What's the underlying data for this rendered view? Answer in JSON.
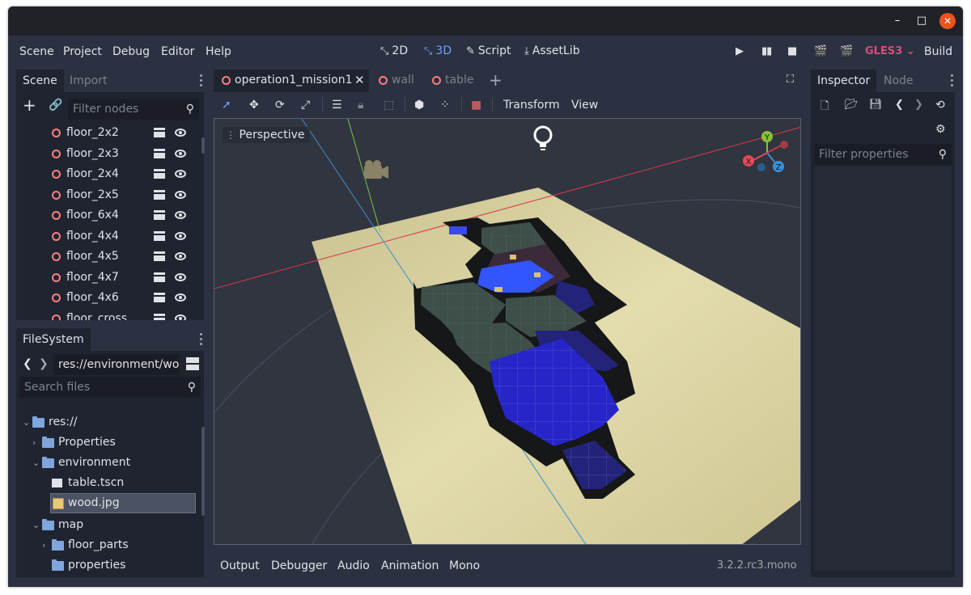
{
  "window": {
    "controls": {
      "minimize": "–",
      "maximize": "□",
      "close": "✕"
    }
  },
  "menu": {
    "items": [
      "Scene",
      "Project",
      "Debug",
      "Editor",
      "Help"
    ],
    "workspaces": [
      {
        "label": "2D",
        "icon": "2d-icon",
        "active": false
      },
      {
        "label": "3D",
        "icon": "3d-icon",
        "active": true
      },
      {
        "label": "Script",
        "icon": "script-icon",
        "active": false
      },
      {
        "label": "AssetLib",
        "icon": "assetlib-icon",
        "active": false
      }
    ],
    "renderer": "GLES3",
    "build_label": "Build",
    "accent_color": "#d7507a"
  },
  "scene_panel": {
    "tabs": [
      "Scene",
      "Import"
    ],
    "filter_placeholder": "Filter nodes",
    "nodes": [
      "floor_2x2",
      "floor_2x3",
      "floor_2x4",
      "floor_2x5",
      "floor_6x4",
      "floor_4x4",
      "floor_4x5",
      "floor_4x7",
      "floor_4x6",
      "floor_cross"
    ]
  },
  "filesystem": {
    "tab": "FileSystem",
    "path": "res://environment/wo",
    "search_placeholder": "Search files",
    "tree": [
      {
        "label": "res://",
        "type": "folder",
        "depth": 0,
        "expanded": true
      },
      {
        "label": "Properties",
        "type": "folder",
        "depth": 1,
        "expanded": false
      },
      {
        "label": "environment",
        "type": "folder",
        "depth": 1,
        "expanded": true
      },
      {
        "label": "table.tscn",
        "type": "scene",
        "depth": 2
      },
      {
        "label": "wood.jpg",
        "type": "image",
        "depth": 2,
        "selected": true
      },
      {
        "label": "map",
        "type": "folder",
        "depth": 1,
        "expanded": true
      },
      {
        "label": "floor_parts",
        "type": "folder",
        "depth": 2,
        "expanded": false
      },
      {
        "label": "properties",
        "type": "folder",
        "depth": 2
      }
    ]
  },
  "editor_tabs": [
    {
      "label": "operation1_mission1",
      "active": true
    },
    {
      "label": "wall",
      "active": false
    },
    {
      "label": "table",
      "active": false
    }
  ],
  "viewport": {
    "menus": [
      "Transform",
      "View"
    ],
    "perspective_label": "Perspective",
    "gizmo": {
      "x": "X",
      "y": "Y",
      "z": "Z"
    }
  },
  "bottom_panel": {
    "items": [
      "Output",
      "Debugger",
      "Audio",
      "Animation",
      "Mono"
    ],
    "version": "3.2.2.rc3.mono"
  },
  "inspector": {
    "tabs": [
      "Inspector",
      "Node"
    ],
    "filter_placeholder": "Filter properties"
  }
}
